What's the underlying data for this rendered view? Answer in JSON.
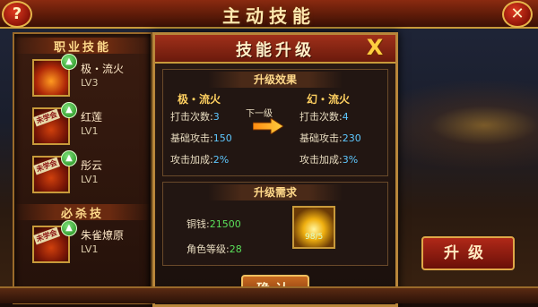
{
  "header": {
    "title": "主动技能",
    "help_label": "?",
    "close_label": "✕"
  },
  "left_panel": {
    "section_professional": "职业技能",
    "section_ultimate": "必杀技",
    "skills": [
      {
        "name": "极・流火",
        "level": "LV3",
        "tag": "",
        "icon": "fire-skill-icon"
      },
      {
        "name": "红莲",
        "level": "LV1",
        "tag": "未学会",
        "icon": "lotus-skill-icon"
      },
      {
        "name": "彤云",
        "level": "LV1",
        "tag": "未学会",
        "icon": "cloud-skill-icon"
      },
      {
        "name": "朱雀燎原",
        "level": "LV1",
        "tag": "未学会",
        "icon": "phoenix-skill-icon"
      }
    ]
  },
  "dialog": {
    "title": "技能升级",
    "close_label": "X",
    "effect": {
      "header": "升级效果",
      "next_label": "下一级",
      "current": {
        "name": "极・流火",
        "hits_label": "打击次数:",
        "hits": "3",
        "base_label": "基础攻击:",
        "base": "150",
        "bonus_label": "攻击加成:",
        "bonus": "2%"
      },
      "next": {
        "name": "幻・流火",
        "hits_label": "打击次数:",
        "hits": "4",
        "base_label": "基础攻击:",
        "base": "230",
        "bonus_label": "攻击加成:",
        "bonus": "3%"
      }
    },
    "requirements": {
      "header": "升级需求",
      "money_label": "铜钱:",
      "money": "21500",
      "level_label": "角色等级:",
      "level": "28",
      "item_count": "98/5"
    },
    "confirm_label": "确认"
  },
  "upgrade_button_label": "升级",
  "colors": {
    "accent_gold": "#c89a3a",
    "value_blue": "#5ec8ff",
    "value_green": "#5ae05a",
    "name_gold": "#ffd060"
  }
}
